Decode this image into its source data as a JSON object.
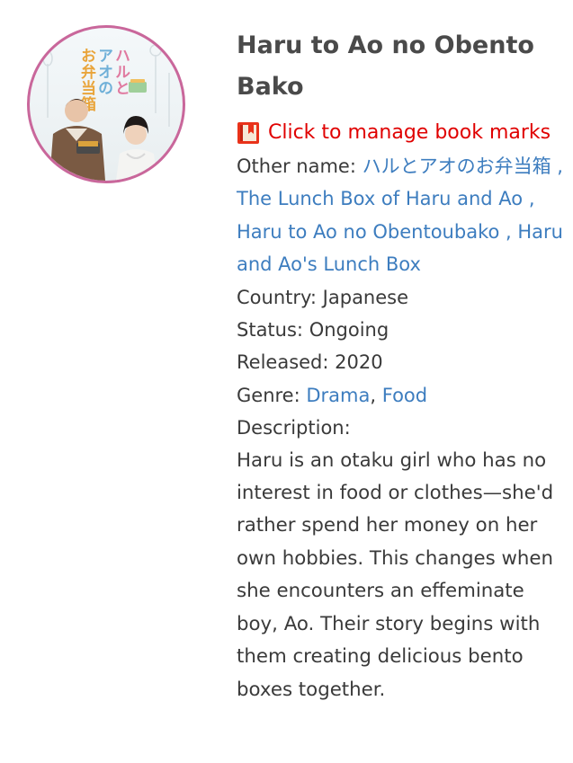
{
  "poster": {
    "title_jp_col1": "ハルと",
    "title_jp_col2": "アオの",
    "title_jp_col3": "お弁当箱"
  },
  "show": {
    "title": "Haru to Ao no Obento Bako",
    "bookmark_label": "Click to manage book marks",
    "other_name_label": "Other name:",
    "other_names": "ハルとアオのお弁当箱 , The Lunch Box of Haru and Ao , Haru to Ao no Obentoubako , Haru and Ao's Lunch Box",
    "country_label": "Country:",
    "country": "Japanese",
    "status_label": "Status:",
    "status": "Ongoing",
    "released_label": "Released:",
    "released": "2020",
    "genre_label": "Genre:",
    "genres": [
      "Drama",
      "Food"
    ],
    "genre_separator": ",",
    "description_label": "Description:",
    "description": "Haru is an otaku girl who has no interest in food or clothes—she'd rather spend her money on her own hobbies. This changes when she encounters an effeminate boy, Ao. Their story begins with them creating delicious bento boxes together."
  },
  "colors": {
    "link": "#3d7dbf",
    "bookmark": "#e00000",
    "poster_border": "#c9679b"
  },
  "icons": {
    "bookmark": "book-bookmark-icon"
  }
}
